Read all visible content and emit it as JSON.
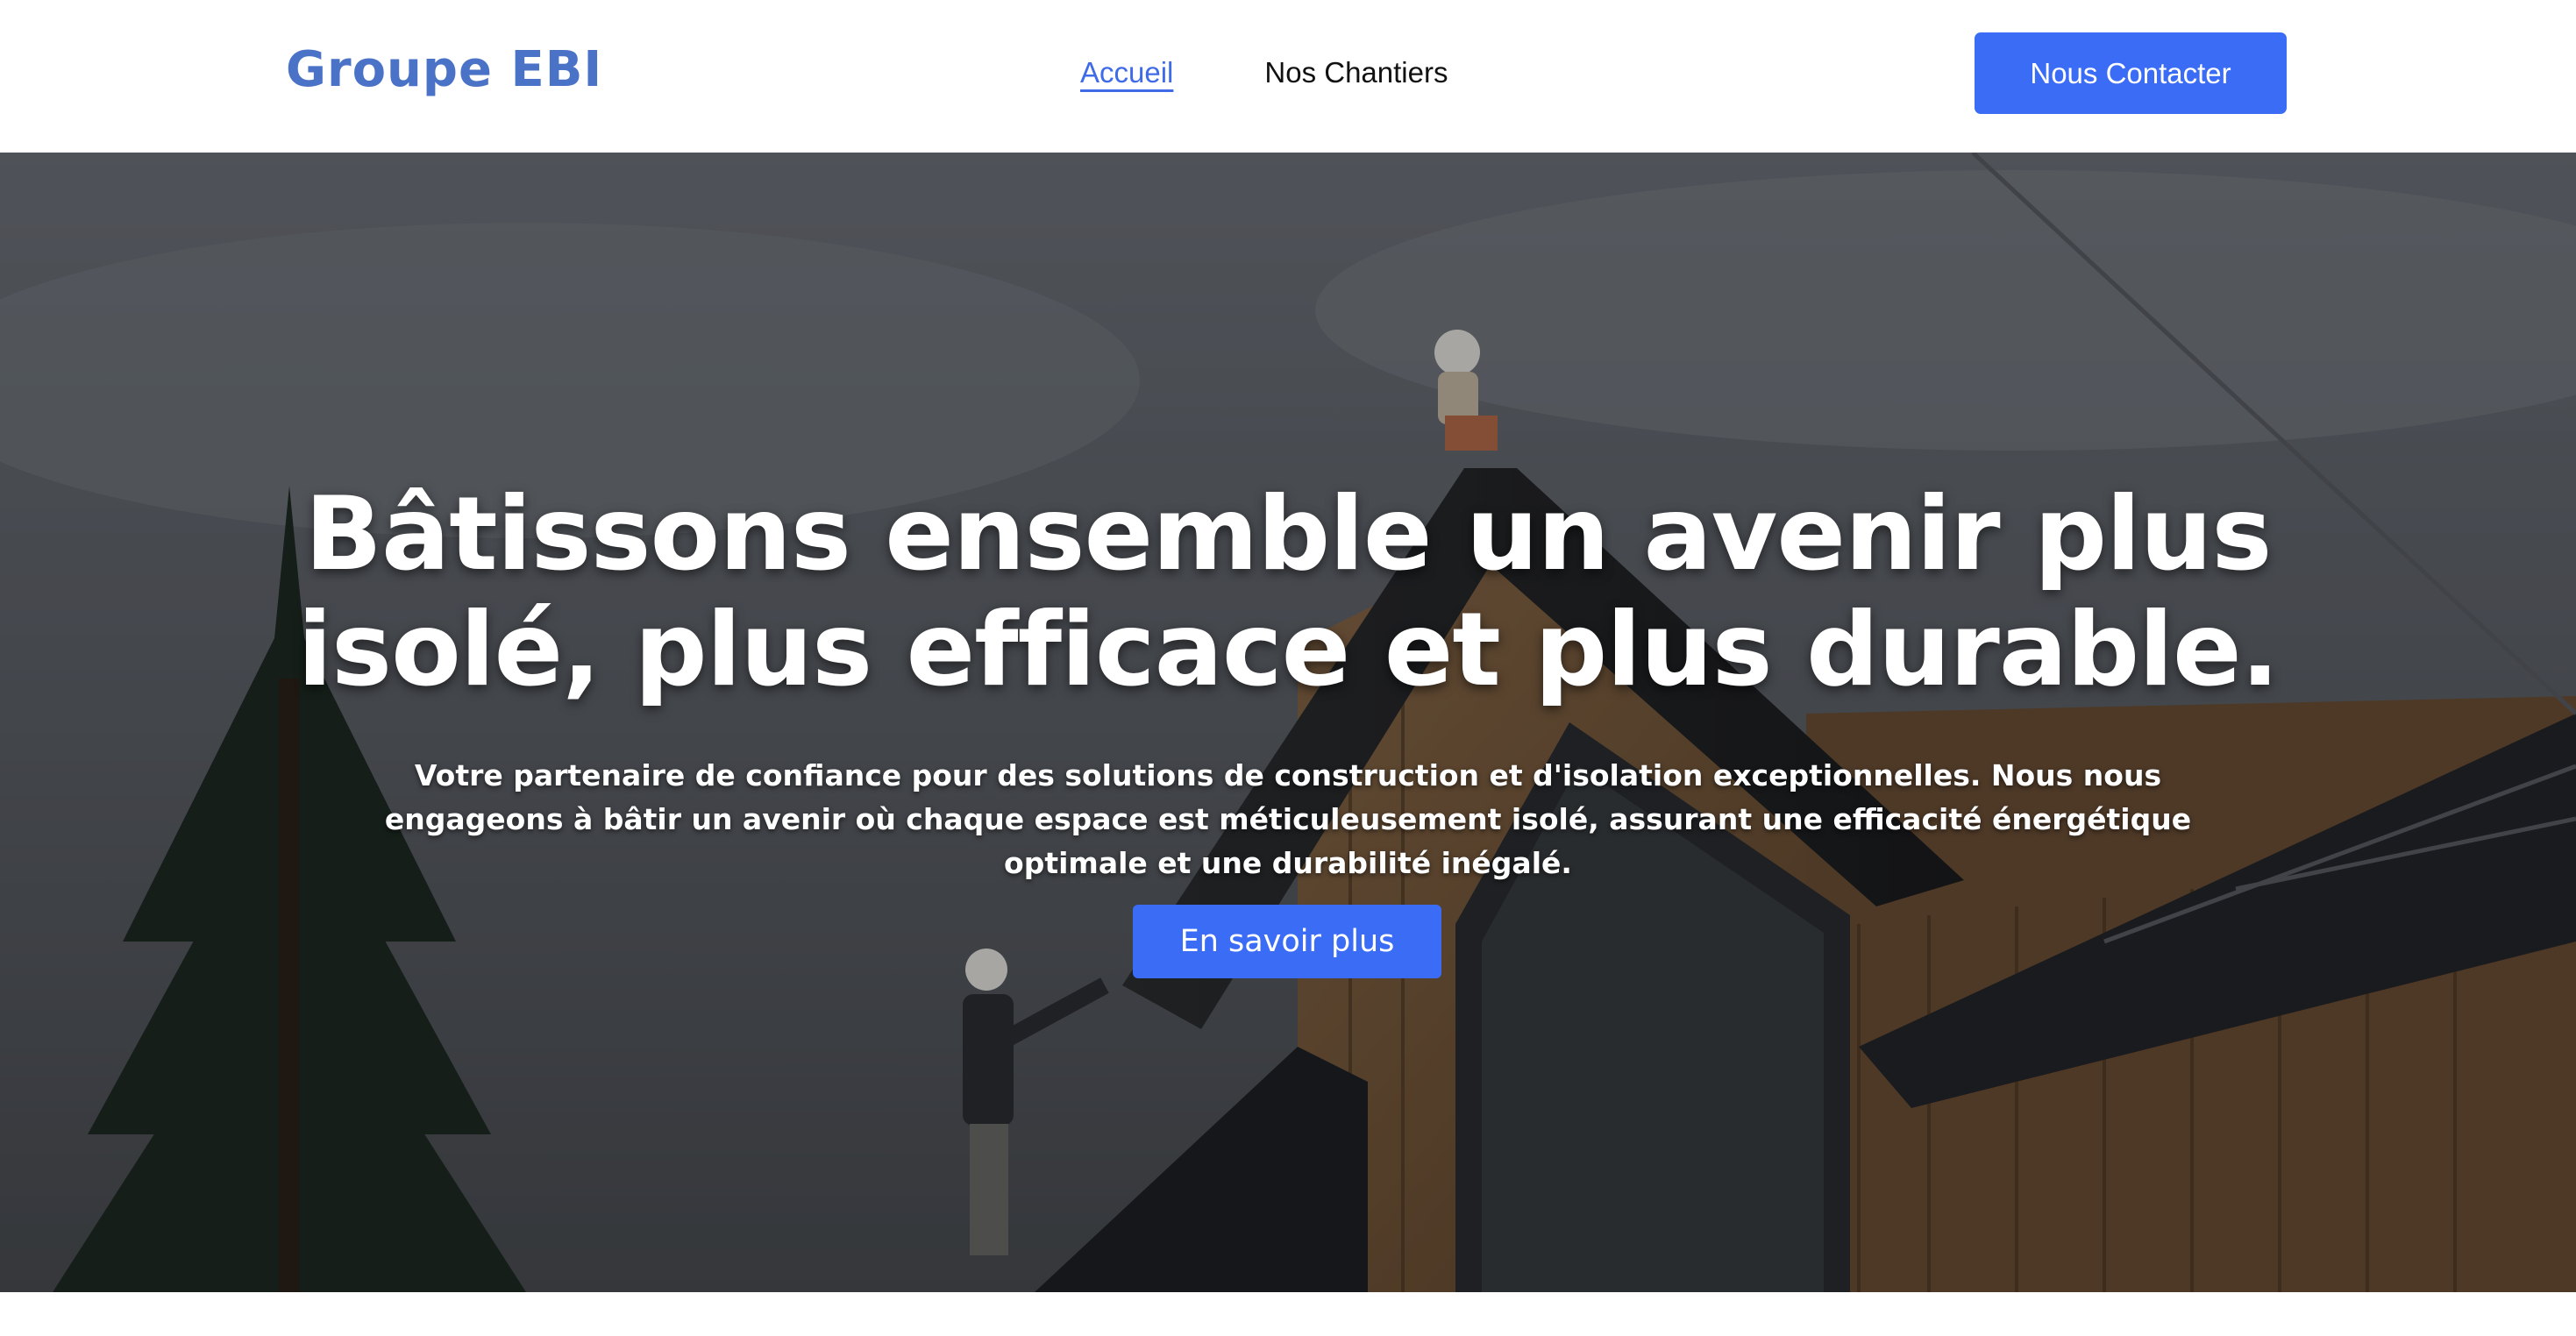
{
  "header": {
    "logo_text": "Groupe EBI",
    "nav": [
      {
        "label": "Accueil",
        "active": true
      },
      {
        "label": "Nos Chantiers",
        "active": false
      }
    ],
    "contact_button": "Nous Contacter"
  },
  "hero": {
    "title": "Bâtissons ensemble un avenir plus isolé, plus efficace et plus durable.",
    "subtitle": "Votre partenaire de confiance pour des solutions de construction et d'isolation exceptionnelles. Nous nous engageons à bâtir un avenir où chaque espace est méticuleusement isolé, assurant une efficacité énergétique optimale et une durabilité inégalé.",
    "button": "En savoir plus"
  },
  "colors": {
    "accent": "#3b6cf6",
    "logo": "#4a72c7",
    "nav_active": "#3f6be8"
  }
}
